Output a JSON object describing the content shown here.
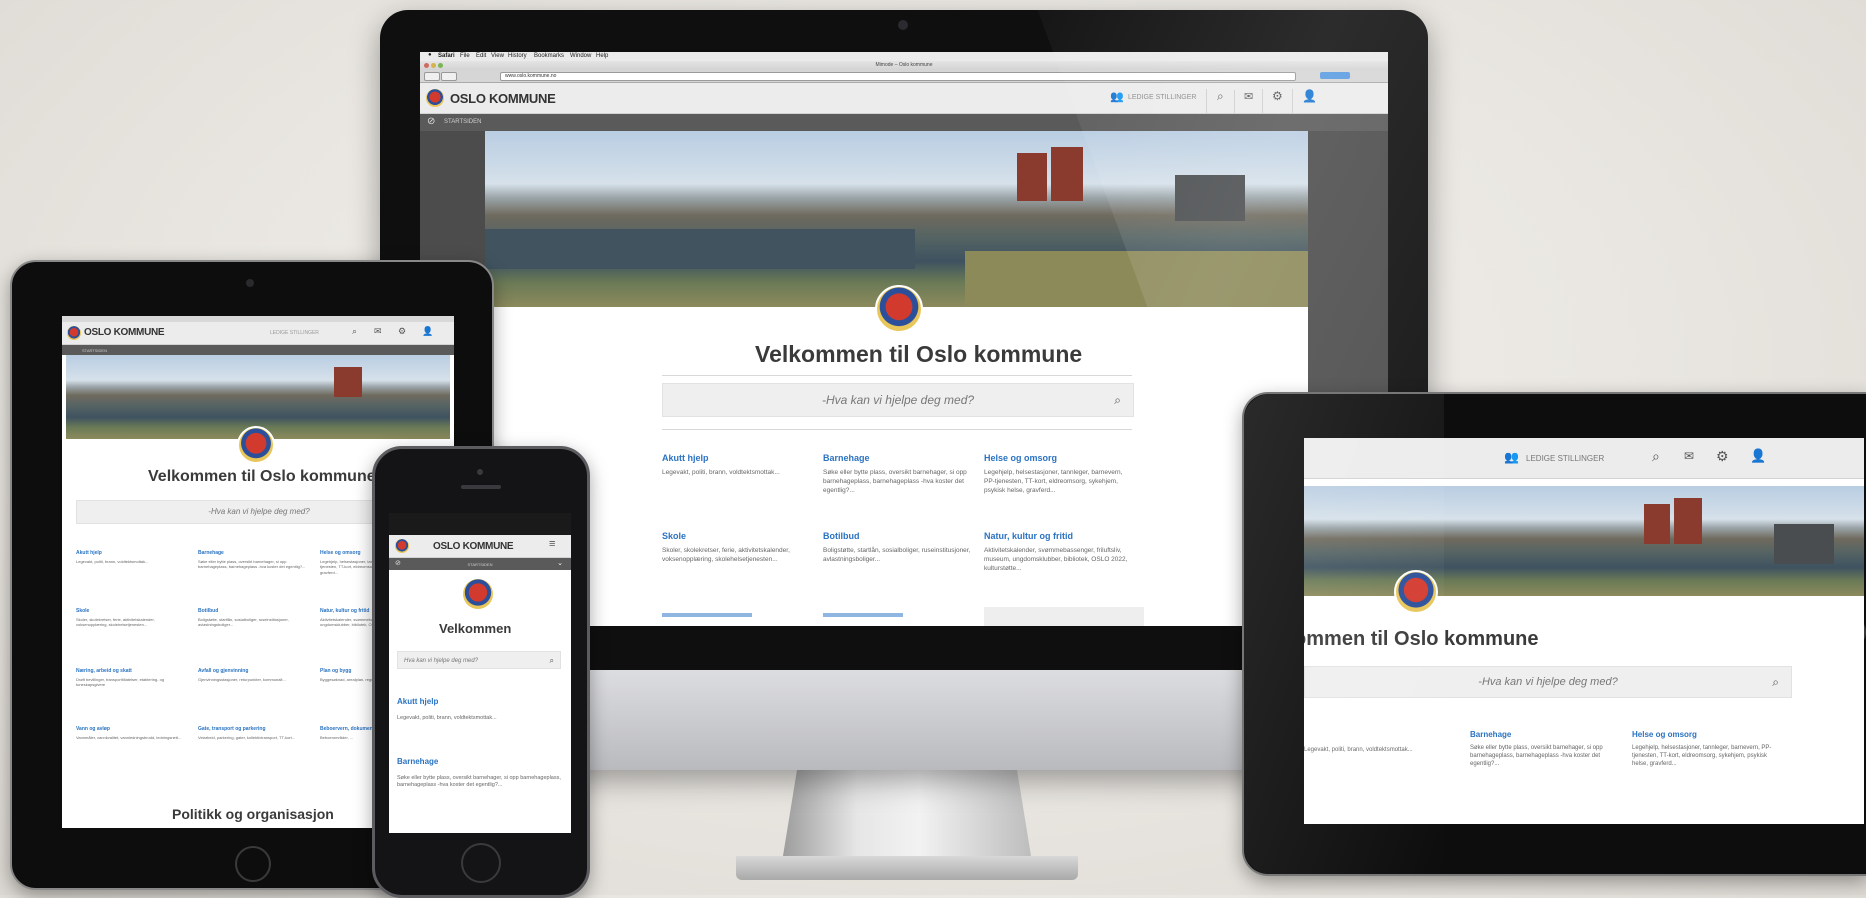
{
  "browser": {
    "menu": [
      "Safari",
      "File",
      "Edit",
      "View",
      "History",
      "Bookmarks",
      "Window",
      "Help"
    ],
    "window_title": "Mimode – Oslo kommune",
    "url": "www.oslo.kommune.no"
  },
  "site": {
    "brand": "OSLO KOMMUNE",
    "brand_short": "OSLO KOMM",
    "jobs": "LEDIGE STILLINGER",
    "breadcrumb": "STARTSIDEN",
    "title": "Velkommen til Oslo kommune",
    "title_mobile": "Velkommen",
    "search_placeholder": "-Hva kan vi hjelpe deg med?",
    "search_placeholder_mobile": "Hva kan vi hjelpe deg med?",
    "politics": "Politikk og organisasjon"
  },
  "links": [
    {
      "title": "Akutt hjelp",
      "desc": "Legevakt, politi, brann, voldtektsmottak..."
    },
    {
      "title": "Barnehage",
      "desc": "Søke eller bytte plass, oversikt barnehager, si opp barnehageplass, barnehageplass -hva koster det egentlig?..."
    },
    {
      "title": "Helse og omsorg",
      "desc": "Legehjelp, helsestasjoner, tannleger, barnevern, PP-tjenesten, TT-kort, eldreomsorg, sykehjem, psykisk helse, gravferd..."
    },
    {
      "title": "Skole",
      "desc": "Skoler, skolekretser, ferie, aktivitetskalender, voksenopplæring, skolehelsetjenesten..."
    },
    {
      "title": "Botilbud",
      "desc": "Boligstøtte, startlån, sosialboliger, ruseinstitusjoner, avlastningsboliger..."
    },
    {
      "title": "Natur, kultur og fritid",
      "desc": "Aktivitetskalender, svømmebassenger, friluftsliv, museum, ungdomsklubber, bibliotek, OSLO 2022, kulturstøtte..."
    }
  ],
  "ipad_links": [
    {
      "title": "Næring, arbeid og skatt",
      "desc": "Drøft bevillinger, transporttillatelser, etablering- og tuneskapsgivere"
    },
    {
      "title": "Avfall og gjenvinning",
      "desc": "Gjenvinningsstasjoner, returpunkter, kommunalt..."
    },
    {
      "title": "Plan og bygg",
      "desc": "Byggesøknad, arealplan, reguleringsplaner"
    },
    {
      "title": "Vann og avløp",
      "desc": "Vannmåler, vannkvalitet, vannledningsbrudd, ledningsnett..."
    },
    {
      "title": "Gate, transport og parkering",
      "desc": "Veiarbeid, parkering, gater, kollektivtransport, TT-kort..."
    },
    {
      "title": "Beboervern, dokumenter",
      "desc": "Beboerområder, ..."
    }
  ],
  "colors": {
    "link": "#2a73c2",
    "bezel": "#0d0d0e",
    "header": "#ececec"
  },
  "icons": [
    "apple-icon",
    "users-icon",
    "search-icon",
    "mail-icon",
    "gear-icon",
    "person-icon",
    "checkmark-circle-icon",
    "menu-icon",
    "chevron-down-icon"
  ]
}
